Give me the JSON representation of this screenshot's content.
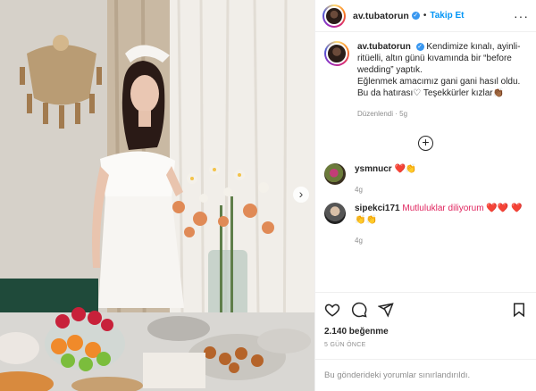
{
  "header": {
    "username": "av.tubatorun",
    "follow_label": "Takip Et",
    "dot": "•",
    "more_icon": "more-horizontal-icon"
  },
  "caption": {
    "username": "av.tubatorun",
    "line1": "Kendimize kınalı, ayinli-ritüelli, altın günü kıvamında bir “before wedding” yaptık.",
    "line2": "Eğlenmek amacımız gani gani hasıl oldu.",
    "line3": "Bu da hatırası♡ Teşekkürler kızlar👏🏾",
    "edited": "Düzenlendi · 5g"
  },
  "comments": [
    {
      "user": "ysmnucr",
      "text": "❤️👏",
      "time": "4g"
    },
    {
      "user": "sipekci171",
      "text": "Mutluluklar diliyorum ❤️❤️ ❤️👏👏",
      "time": "4g"
    }
  ],
  "actions": {
    "likes": "2.140 beğenme",
    "date": "5 GÜN ÖNCE",
    "restricted": "Bu gönderideki yorumlar sınırlandırıldı."
  },
  "media": {
    "next_arrow": "›"
  }
}
